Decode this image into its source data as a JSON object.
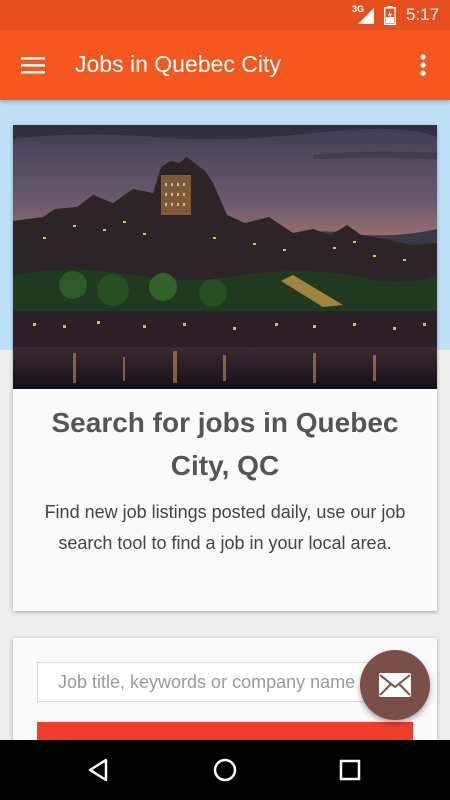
{
  "status_bar": {
    "network": "3G",
    "time": "5:17"
  },
  "app_bar": {
    "title": "Jobs in Quebec City",
    "menu_icon": "hamburger-menu-icon",
    "overflow_icon": "more-vert-icon"
  },
  "hero": {
    "image": "quebec-city-skyline-at-dusk",
    "headline": "Search for jobs in Quebec City, QC",
    "description": "Find new job listings posted daily, use our job search tool to find a job in your local area."
  },
  "search": {
    "placeholder": "Job title, keywords or company name",
    "value": "",
    "button_label": ""
  },
  "fab": {
    "icon": "mail-icon"
  },
  "nav_bar": {
    "back_icon": "back-triangle-icon",
    "home_icon": "home-circle-icon",
    "recents_icon": "recents-square-icon"
  },
  "colors": {
    "status_bar": "#e6501f",
    "app_bar": "#f4581f",
    "hero_background": "#bfe1f8",
    "search_button": "#f03d2c",
    "fab": "#7b4f45"
  }
}
